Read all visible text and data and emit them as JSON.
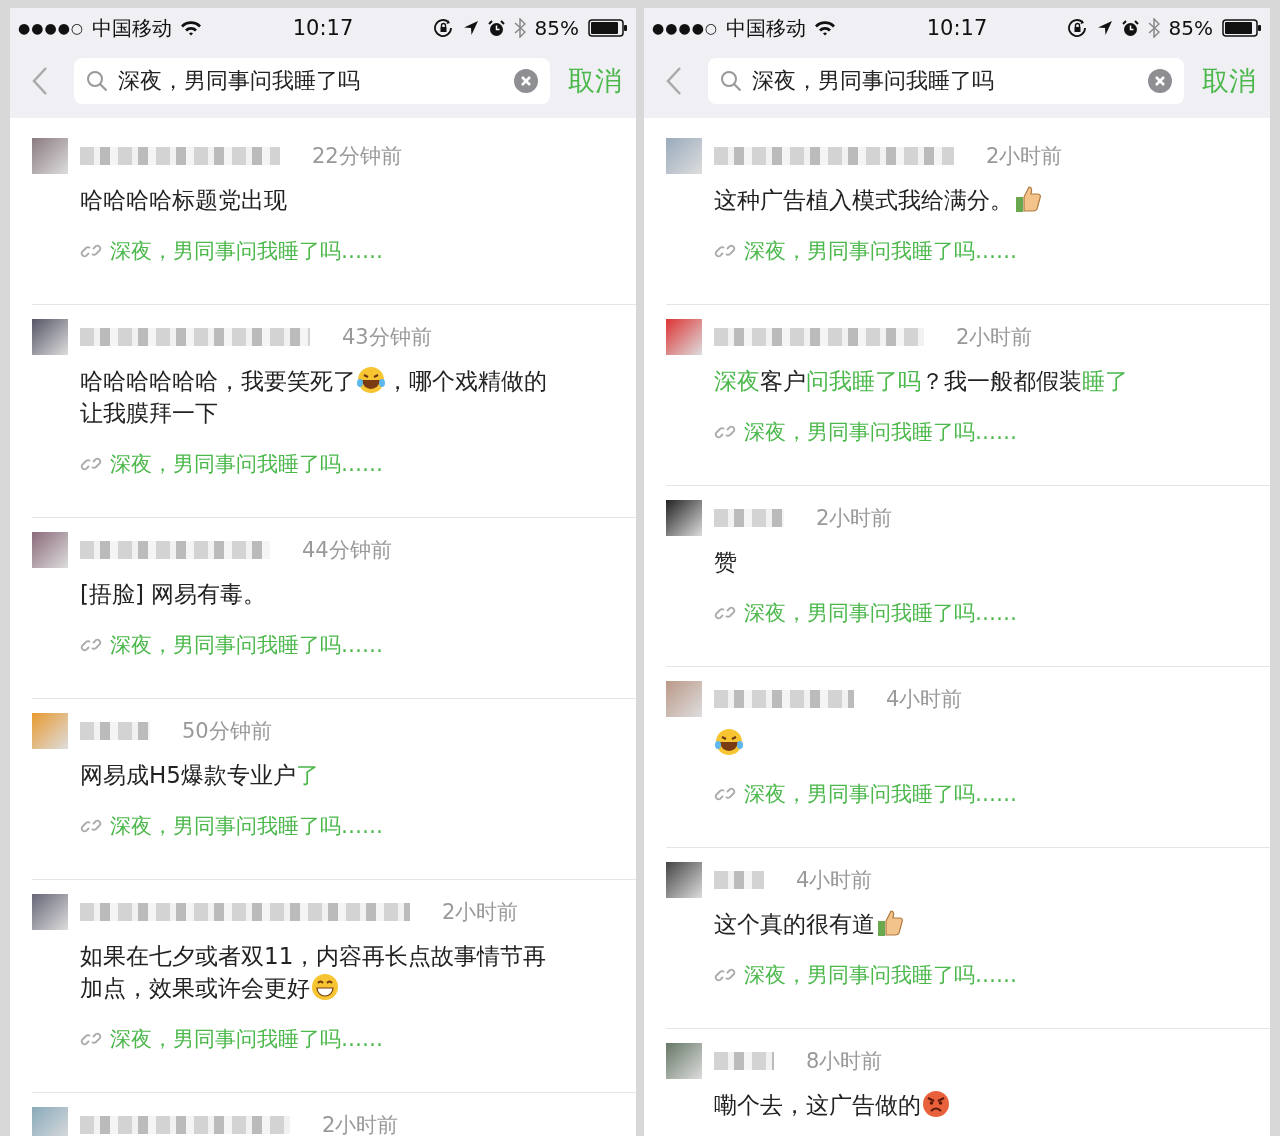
{
  "panels": [
    {
      "status_bar": {
        "signal_dots": "●●●●○",
        "carrier": "中国移动",
        "time": "10:17",
        "battery": "85%"
      },
      "search": {
        "value": "深夜，男同事问我睡了吗",
        "cancel": "取消"
      },
      "comments": [
        {
          "time": "22分钟前",
          "lines": [
            [
              {
                "kind": "text",
                "text": "哈哈哈哈标题党出现",
                "highlight": false
              }
            ]
          ],
          "link": "深夜，男同事问我睡了吗……"
        },
        {
          "time": "43分钟前",
          "lines": [
            [
              {
                "kind": "text",
                "text": "哈哈哈哈哈哈，我要笑死了",
                "highlight": false
              },
              {
                "kind": "tearsofjoy"
              },
              {
                "kind": "text",
                "text": "，哪个戏精做的",
                "highlight": false
              }
            ],
            [
              {
                "kind": "text",
                "text": "让我膜拜一下",
                "highlight": false
              }
            ]
          ],
          "link": "深夜，男同事问我睡了吗……"
        },
        {
          "time": "44分钟前",
          "lines": [
            [
              {
                "kind": "text",
                "text": "[捂脸] 网易有毒。",
                "highlight": false
              }
            ]
          ],
          "link": "深夜，男同事问我睡了吗……"
        },
        {
          "time": "50分钟前",
          "lines": [
            [
              {
                "kind": "text",
                "text": "网易成H5爆款专业户",
                "highlight": false
              },
              {
                "kind": "text",
                "text": "了",
                "highlight": true
              }
            ]
          ],
          "link": "深夜，男同事问我睡了吗……"
        },
        {
          "time": "2小时前",
          "lines": [
            [
              {
                "kind": "text",
                "text": "如果在七夕或者双11，内容再长点故事情节再",
                "highlight": false
              }
            ],
            [
              {
                "kind": "text",
                "text": "加点，效果或许会更好",
                "highlight": false
              },
              {
                "kind": "grin"
              }
            ]
          ],
          "link": "深夜，男同事问我睡了吗……"
        },
        {
          "time": "2小时前"
        }
      ]
    },
    {
      "status_bar": {
        "signal_dots": "●●●●○",
        "carrier": "中国移动",
        "time": "10:17",
        "battery": "85%"
      },
      "search": {
        "value": "深夜，男同事问我睡了吗",
        "cancel": "取消"
      },
      "comments": [
        {
          "time": "2小时前",
          "lines": [
            [
              {
                "kind": "text",
                "text": "这种广告植入模式我给满分。",
                "highlight": false
              },
              {
                "kind": "thumbsup"
              }
            ]
          ],
          "link": "深夜，男同事问我睡了吗……"
        },
        {
          "time": "2小时前",
          "lines": [
            [
              {
                "kind": "text",
                "text": "深夜",
                "highlight": true
              },
              {
                "kind": "text",
                "text": "客户",
                "highlight": false
              },
              {
                "kind": "text",
                "text": "问我睡了吗",
                "highlight": true
              },
              {
                "kind": "text",
                "text": "？我一般都假装",
                "highlight": false
              },
              {
                "kind": "text",
                "text": "睡了",
                "highlight": true
              }
            ]
          ],
          "link": "深夜，男同事问我睡了吗……"
        },
        {
          "time": "2小时前",
          "lines": [
            [
              {
                "kind": "text",
                "text": "赞",
                "highlight": false
              }
            ]
          ],
          "link": "深夜，男同事问我睡了吗……"
        },
        {
          "time": "4小时前",
          "lines": [
            [
              {
                "kind": "tearsofjoy"
              }
            ]
          ],
          "link": "深夜，男同事问我睡了吗……"
        },
        {
          "time": "4小时前",
          "lines": [
            [
              {
                "kind": "text",
                "text": "这个真的很有道",
                "highlight": false
              },
              {
                "kind": "thumbsup"
              }
            ]
          ],
          "link": "深夜，男同事问我睡了吗……"
        },
        {
          "time": "8小时前",
          "lines": [
            [
              {
                "kind": "text",
                "text": "嘞个去，这广告做的",
                "highlight": false
              },
              {
                "kind": "angry"
              }
            ]
          ]
        }
      ]
    }
  ]
}
